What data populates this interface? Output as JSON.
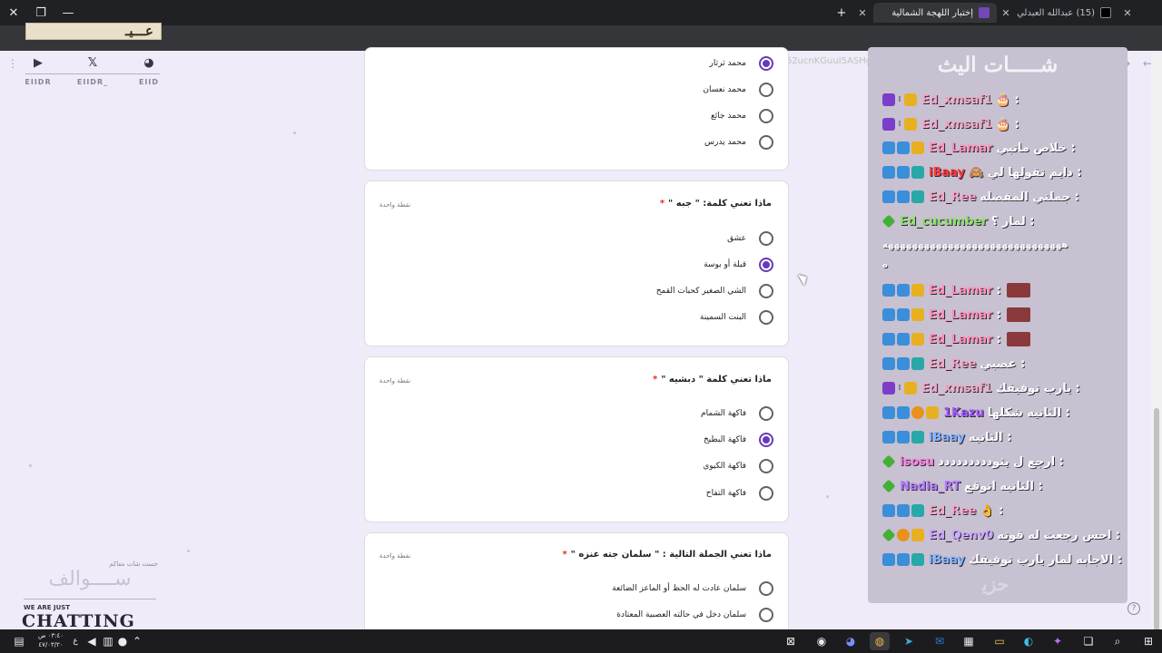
{
  "browser": {
    "tabs": [
      {
        "title": "(15) عبدالله العبدلي X :on \"اختبار...",
        "icon_color": "#1d1d1d"
      },
      {
        "title": "إختبار اللهجة الشمالية",
        "icon_color": "#7248b9"
      }
    ],
    "url": "docs.google.com/forms/d/e/1FAIpQLScfvfF62ucnKGuuI5ASHgjBrXGAll8YXwxHciWiYdReVgyNGg/viewform"
  },
  "overlay_banner": "عـــيـ",
  "social": [
    {
      "icon": "youtube-icon",
      "glyph": "▶",
      "label": "EIIDR"
    },
    {
      "icon": "x-icon",
      "glyph": "𝕏",
      "label": "EIIDR_"
    },
    {
      "icon": "discord-icon",
      "glyph": "◕",
      "label": "EIID"
    }
  ],
  "branding": {
    "subtitle": "جست شات معاكم",
    "arabic_title": "ســــوالف",
    "small_text": "WE ARE JUST",
    "big_text": "CHATTING"
  },
  "form": {
    "top_options": [
      {
        "label": "محمد ثرثار",
        "selected": true
      },
      {
        "label": "محمد نعسان",
        "selected": false
      },
      {
        "label": "محمد جائع",
        "selected": false
      },
      {
        "label": "محمد يدرس",
        "selected": false
      }
    ],
    "questions": [
      {
        "title": "ماذا تعني كلمة: \" جبه \"",
        "required_mark": "*",
        "points": "نقطة واحدة",
        "options": [
          {
            "label": "عشق",
            "selected": false
          },
          {
            "label": "قبلة أو بوسة",
            "selected": true
          },
          {
            "label": "الشي الصغير كحبات القمح",
            "selected": false
          },
          {
            "label": "البنت السمينة",
            "selected": false
          }
        ]
      },
      {
        "title": "ماذا تعني كلمة \" دبشيه \"",
        "required_mark": "*",
        "points": "نقطة واحدة",
        "options": [
          {
            "label": "فاكهة الشمام",
            "selected": false
          },
          {
            "label": "فاكهة البطيخ",
            "selected": true
          },
          {
            "label": "فاكهة الكيوي",
            "selected": false
          },
          {
            "label": "فاكهة التفاح",
            "selected": false
          }
        ]
      },
      {
        "title": "ماذا تعني الجملة التالية : \" سلمان جته عنزه \"",
        "required_mark": "*",
        "points": "نقطة واحدة",
        "options": [
          {
            "label": "سلمان عادت له الحظ أو الماعز الضائعة",
            "selected": false
          },
          {
            "label": "سلمان دخل في حالته العصبية المعتادة",
            "selected": false
          }
        ]
      }
    ]
  },
  "chat": {
    "title": "شـــــات اليث",
    "messages": [
      {
        "badges": [
          "purple",
          "dot",
          "gold"
        ],
        "user": "Ed_xmsaf1",
        "color": "#f2a7c7",
        "text": ": 🎂"
      },
      {
        "badges": [
          "purple",
          "dot",
          "gold"
        ],
        "user": "Ed_xmsaf1",
        "color": "#f2a7c7",
        "text": ": 🎂"
      },
      {
        "badges": [
          "blue",
          "blue",
          "gold"
        ],
        "user": "Ed_Lamar",
        "color": "#ff8fb8",
        "text": ": خلاص ماتبي"
      },
      {
        "badges": [
          "blue",
          "blue",
          "teal"
        ],
        "user": "iBaay",
        "color": "#ff3b3b",
        "text": ": دايم تقولها لي 🙈"
      },
      {
        "badges": [
          "blue",
          "blue",
          "teal"
        ],
        "user": "Ed_Ree",
        "color": "#f2a7c7",
        "text": ": جملتي المفضله"
      },
      {
        "badges": [
          "green"
        ],
        "user": "Ed_cucumber",
        "color": "#8ee06c",
        "text": ": لمار ؟"
      },
      {
        "badges": [],
        "user": "",
        "color": "#ffffff",
        "text": "ههههههههههههههههههههههههههههههه"
      },
      {
        "badges": [],
        "user": "",
        "color": "#ffffff",
        "text": "ه"
      },
      {
        "badges": [
          "blue",
          "blue",
          "gold"
        ],
        "user": "Ed_Lamar",
        "color": "#ff8fb8",
        "text": ":",
        "emote": true
      },
      {
        "badges": [
          "blue",
          "blue",
          "gold"
        ],
        "user": "Ed_Lamar",
        "color": "#ff8fb8",
        "text": ":",
        "emote": true
      },
      {
        "badges": [
          "blue",
          "blue",
          "gold"
        ],
        "user": "Ed_Lamar",
        "color": "#ff8fb8",
        "text": ":",
        "emote": true
      },
      {
        "badges": [
          "blue",
          "blue",
          "teal"
        ],
        "user": "Ed_Ree",
        "color": "#f2a7c7",
        "text": ": عصبي"
      },
      {
        "badges": [
          "purple",
          "dot",
          "gold"
        ],
        "user": "Ed_xmsaf1",
        "color": "#f2a7c7",
        "text": ": يارب توفيقك"
      },
      {
        "badges": [
          "blue",
          "blue",
          "orange",
          "gold"
        ],
        "user": "1Kazu",
        "color": "#a259ff",
        "text": ": الثانيه شكلها"
      },
      {
        "badges": [
          "blue",
          "blue",
          "teal"
        ],
        "user": "iBaay",
        "color": "#7fb2ff",
        "text": ": الثانيه"
      },
      {
        "badges": [
          "green"
        ],
        "user": "isosu",
        "color": "#ff7be0",
        "text": ": ارجع ل يثوددددددددد"
      },
      {
        "badges": [
          "green"
        ],
        "user": "Nadia_RT",
        "color": "#b57dff",
        "text": ": الثانيه اتوقع"
      },
      {
        "badges": [
          "blue",
          "blue",
          "teal"
        ],
        "user": "Ed_Ree",
        "color": "#f2a7c7",
        "text": ": 👌"
      },
      {
        "badges": [
          "green",
          "orange",
          "gold"
        ],
        "user": "Ed_Qenv0",
        "color": "#c9a4ff",
        "text": ": احس رجعت له قوته"
      },
      {
        "badges": [
          "blue",
          "blue",
          "teal"
        ],
        "user": "iBaay",
        "color": "#7fb2ff",
        "text": ": الاجابه لمار يارب توفيقك"
      }
    ],
    "logo": "ﺣﺰﻳ"
  },
  "taskbar": {
    "clock_time": "٠٣:٤٠ ص",
    "clock_date": "٤٧/٠٣/٢٠",
    "lang": "ع"
  },
  "help_glyph": "?"
}
